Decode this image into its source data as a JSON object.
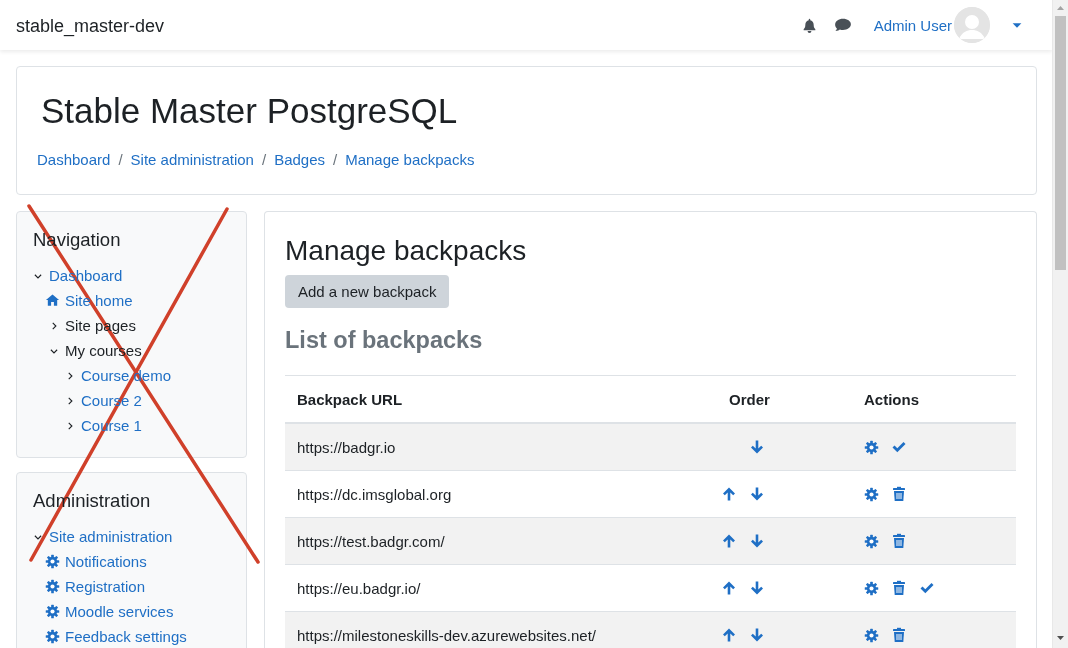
{
  "navbar": {
    "site_name": "stable_master-dev",
    "user_name": "Admin User"
  },
  "page_header": {
    "title": "Stable Master PostgreSQL",
    "breadcrumbs": [
      {
        "kind": "link",
        "text": "Dashboard"
      },
      {
        "kind": "separator",
        "text": "/"
      },
      {
        "kind": "link",
        "text": "Site administration"
      },
      {
        "kind": "separator",
        "text": "/"
      },
      {
        "kind": "link",
        "text": "Badges"
      },
      {
        "kind": "separator",
        "text": "/"
      },
      {
        "kind": "link",
        "text": "Manage backpacks"
      }
    ]
  },
  "blocks": [
    {
      "title": "Navigation",
      "items": [
        {
          "kind": "branch",
          "label": "Dashboard",
          "link": true,
          "expanded": true,
          "children": [
            {
              "kind": "home",
              "label": "Site home",
              "link": true
            },
            {
              "kind": "branch",
              "label": "Site pages",
              "link": false,
              "expanded": false
            },
            {
              "kind": "branch",
              "label": "My courses",
              "link": false,
              "expanded": true,
              "children": [
                {
                  "kind": "branch",
                  "label": "Course demo",
                  "link": true,
                  "expanded": false
                },
                {
                  "kind": "branch",
                  "label": "Course 2",
                  "link": true,
                  "expanded": false
                },
                {
                  "kind": "branch",
                  "label": "Course 1",
                  "link": true,
                  "expanded": false
                }
              ]
            }
          ]
        }
      ]
    },
    {
      "title": "Administration",
      "items": [
        {
          "kind": "branch",
          "label": "Site administration",
          "link": true,
          "expanded": true,
          "children": [
            {
              "kind": "setting",
              "label": "Notifications",
              "link": true
            },
            {
              "kind": "setting",
              "label": "Registration",
              "link": true
            },
            {
              "kind": "setting",
              "label": "Moodle services",
              "link": true
            },
            {
              "kind": "setting",
              "label": "Feedback settings",
              "link": true
            }
          ]
        }
      ]
    }
  ],
  "main": {
    "heading": "Manage backpacks",
    "add_button": "Add a new backpack",
    "list_heading": "List of backpacks",
    "table": {
      "columns": [
        "Backpack URL",
        "Order",
        "Actions"
      ],
      "rows": [
        {
          "url": "https://badgr.io",
          "move_up": false,
          "move_down": true,
          "deletable": false,
          "checkmark": true
        },
        {
          "url": "https://dc.imsglobal.org",
          "move_up": true,
          "move_down": true,
          "deletable": true,
          "checkmark": false
        },
        {
          "url": "https://test.badgr.com/",
          "move_up": true,
          "move_down": true,
          "deletable": true,
          "checkmark": false
        },
        {
          "url": "https://eu.badgr.io/",
          "move_up": true,
          "move_down": true,
          "deletable": true,
          "checkmark": true
        },
        {
          "url": "https://milestoneskills-dev.azurewebsites.net/",
          "move_up": true,
          "move_down": true,
          "deletable": true,
          "checkmark": false
        }
      ]
    }
  }
}
